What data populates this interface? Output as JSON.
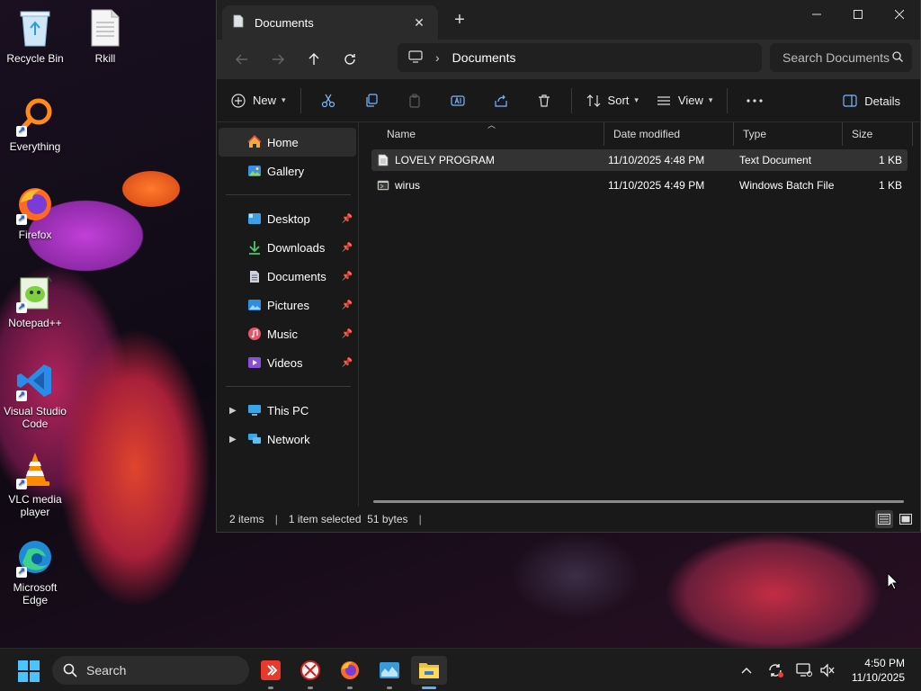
{
  "desktop": {
    "icons": [
      {
        "label": "Recycle Bin"
      },
      {
        "label": "Rkill"
      },
      {
        "label": "Everything"
      },
      {
        "label": "Firefox"
      },
      {
        "label": "Notepad++"
      },
      {
        "label": "Visual Studio Code"
      },
      {
        "label": "VLC media player"
      },
      {
        "label": "Microsoft Edge"
      }
    ]
  },
  "explorer": {
    "tab_title": "Documents",
    "address": {
      "location": "Documents"
    },
    "search": {
      "placeholder": "Search Documents"
    },
    "toolbar": {
      "new_label": "New",
      "sort_label": "Sort",
      "view_label": "View",
      "details_label": "Details"
    },
    "sidebar": {
      "items": [
        {
          "label": "Home"
        },
        {
          "label": "Gallery"
        },
        {
          "label": "Desktop"
        },
        {
          "label": "Downloads"
        },
        {
          "label": "Documents"
        },
        {
          "label": "Pictures"
        },
        {
          "label": "Music"
        },
        {
          "label": "Videos"
        },
        {
          "label": "This PC"
        },
        {
          "label": "Network"
        }
      ]
    },
    "columns": {
      "name": "Name",
      "date": "Date modified",
      "type": "Type",
      "size": "Size"
    },
    "files": [
      {
        "name": "LOVELY PROGRAM",
        "date": "11/10/2025 4:48 PM",
        "type": "Text Document",
        "size": "1 KB"
      },
      {
        "name": "wirus",
        "date": "11/10/2025 4:49 PM",
        "type": "Windows Batch File",
        "size": "1 KB"
      }
    ],
    "status": {
      "count": "2 items",
      "selection": "1 item selected  51 bytes"
    }
  },
  "taskbar": {
    "search_label": "Search",
    "time": "4:50 PM",
    "date": "11/10/2025"
  },
  "colors": {
    "accent": "#5fb2f2",
    "folder": "#f2c033"
  }
}
